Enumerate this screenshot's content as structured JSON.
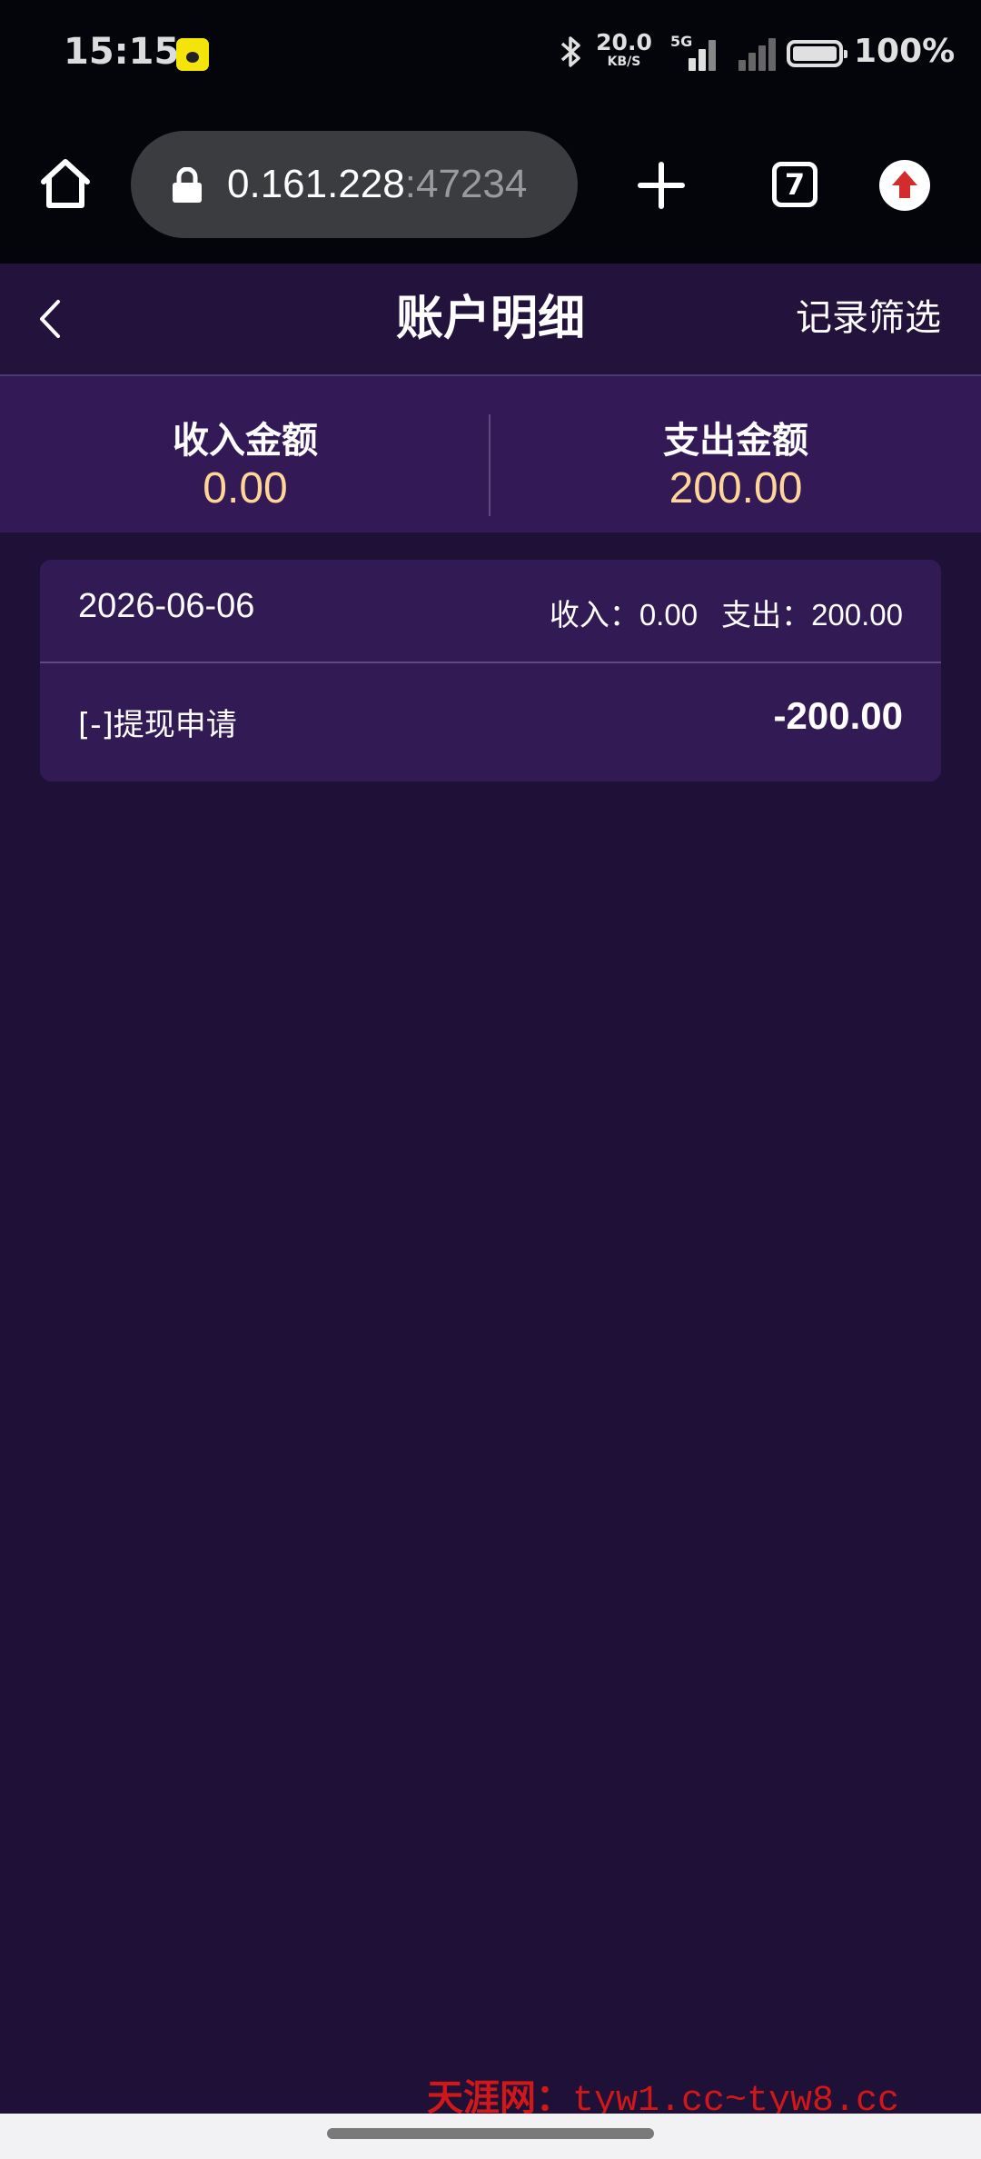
{
  "status_bar": {
    "time": "15:15",
    "speed_value": "20.0",
    "speed_unit": "KB/S",
    "network_type": "5G",
    "battery_percent": "100%"
  },
  "browser": {
    "url_host": "0.161.228",
    "url_port": ":47234",
    "tab_count": "7"
  },
  "header": {
    "title": "账户明细",
    "filter_label": "记录筛选"
  },
  "summary": {
    "income_label": "收入金额",
    "income_value": "0.00",
    "expense_label": "支出金额",
    "expense_value": "200.00"
  },
  "records": [
    {
      "date": "2026-06-06",
      "income_text": "收入：0.00",
      "expense_text": "支出：200.00",
      "item_label": "[-]提现申请",
      "amount": "-200.00"
    }
  ],
  "watermark": {
    "name": "天涯网：",
    "url": "tyw1.cc~tyw8.cc"
  },
  "colors": {
    "page_background": "#1f1038",
    "header_background": "#22123c",
    "summary_background": "#331a56",
    "card_background": "#321b55",
    "amount_accent": "#ffd697",
    "watermark": "#d11818"
  },
  "icons": {
    "home": "home-icon",
    "lock": "lock-icon",
    "new_tab": "plus-icon",
    "update": "arrow-up-icon",
    "back": "chevron-left-icon",
    "bluetooth": "bluetooth-icon",
    "battery": "battery-icon"
  }
}
